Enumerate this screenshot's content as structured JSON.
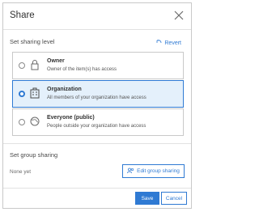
{
  "dialog": {
    "title": "Share",
    "close_icon": "close-icon"
  },
  "sharing_level": {
    "heading": "Set sharing level",
    "revert_label": "Revert",
    "options": [
      {
        "label": "Owner",
        "description": "Owner of the item(s) has access",
        "icon": "lock-icon",
        "selected": false
      },
      {
        "label": "Organization",
        "description": "All members of your organization have access",
        "icon": "building-icon",
        "selected": true
      },
      {
        "label": "Everyone (public)",
        "description": "People outside your organization have access",
        "icon": "globe-icon",
        "selected": false
      }
    ]
  },
  "group_sharing": {
    "heading": "Set group sharing",
    "status": "None yet",
    "edit_label": "Edit group sharing"
  },
  "footer": {
    "save_label": "Save",
    "cancel_label": "Cancel"
  },
  "colors": {
    "accent": "#2f7ad3",
    "selected_bg": "#e4f0fb"
  }
}
